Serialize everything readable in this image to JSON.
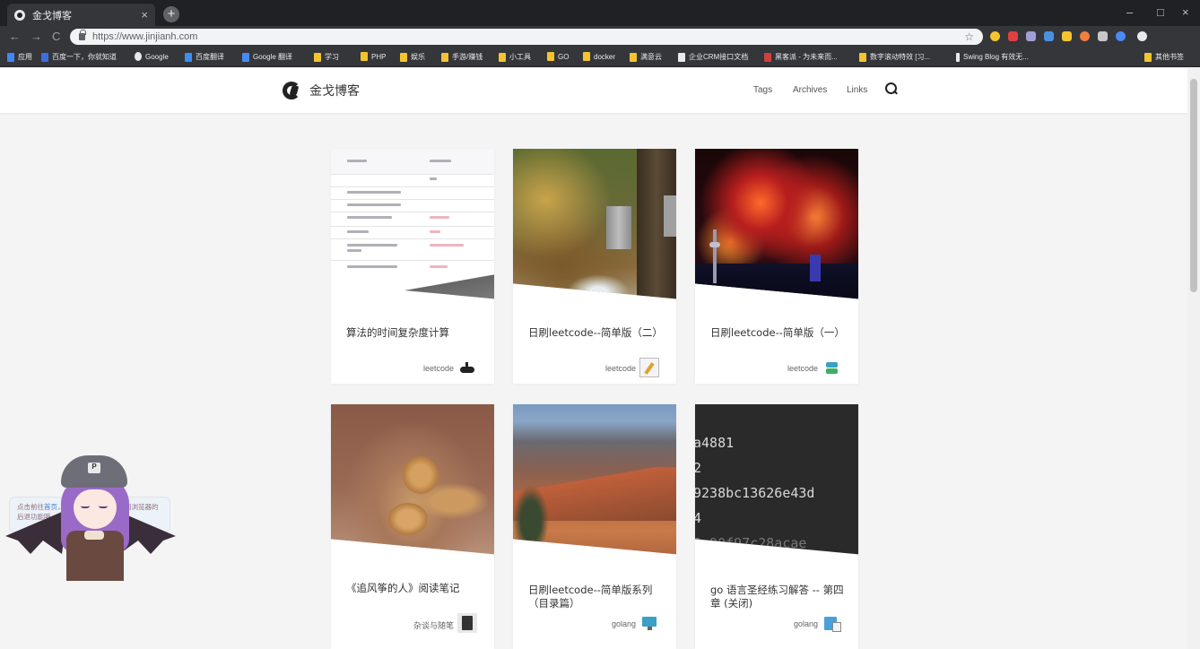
{
  "browser": {
    "tab_title": "金戈博客",
    "tab_close": "×",
    "new_tab": "+",
    "url": "https://www.jinjianh.com",
    "star": "☆",
    "window_controls": [
      "–",
      "□",
      "×"
    ],
    "nav_back": "←",
    "nav_forward": "→",
    "nav_reload": "C",
    "bookmarks": [
      {
        "label": "应用",
        "color": "#4285f4"
      },
      {
        "label": "百度一下，你就知道",
        "color": "#3b6fe0"
      },
      {
        "label": "Google",
        "color": "#e8eaed"
      },
      {
        "label": "百度翻译",
        "color": "#3b8ff0"
      },
      {
        "label": "Google 翻译",
        "color": "#4a8af4"
      },
      {
        "label": "学习",
        "color": "#f4c430"
      },
      {
        "label": "PHP",
        "color": "#f4c430"
      },
      {
        "label": "娱乐",
        "color": "#f4c430"
      },
      {
        "label": "手游/赚钱",
        "color": "#f4c430"
      },
      {
        "label": "小工具",
        "color": "#f4c430"
      },
      {
        "label": "GO",
        "color": "#f4c430"
      },
      {
        "label": "docker",
        "color": "#f4c430"
      },
      {
        "label": "满意云",
        "color": "#f4c430"
      },
      {
        "label": "企业CRM接口文档",
        "color": "#e8eaed"
      },
      {
        "label": "黑客派 - 为未来而...",
        "color": "#d04040"
      },
      {
        "label": "数字滚动特效 [习...",
        "color": "#f4c430"
      },
      {
        "label": "Swing Blog 有效无...",
        "color": "#e8eaed"
      },
      {
        "label": "其他书签",
        "color": "#f4c430"
      }
    ]
  },
  "site": {
    "name": "金戈博客",
    "nav": [
      "Tags",
      "Archives",
      "Links"
    ],
    "search_icon": "search-icon"
  },
  "posts": [
    {
      "title": "算法的时间复杂度计算",
      "category": "leetcode",
      "image": "table-screenshot",
      "emoji": "gamepad-icon"
    },
    {
      "title": "日刷leetcode--简单版（二）",
      "category": "leetcode",
      "image": "forest-photo",
      "emoji": "memo-icon"
    },
    {
      "title": "日刷leetcode--简单版（一）",
      "category": "leetcode",
      "image": "fireworks-photo",
      "emoji": "stack-icon"
    },
    {
      "title": "《追风筝的人》阅读笔记",
      "category": "杂谈与随笔",
      "image": "lion-cubs-photo",
      "emoji": "book-icon"
    },
    {
      "title": "日刷leetcode--简单版系列（目录篇）",
      "category": "golang",
      "image": "canyon-photo",
      "emoji": "monitor-icon"
    },
    {
      "title": "go 语言圣经练习解答 -- 第四章 (关闭)",
      "category": "golang",
      "image": "code-screenshot",
      "emoji": "card-icon"
    }
  ],
  "code_lines": [
    "a4881",
    "2",
    "9238bc13626e43d",
    "4",
    "8a90f97c28acae"
  ],
  "table_thumb": {
    "header_cols": [
      "数据结构",
      "时间复杂度"
    ],
    "rows": [
      "Graph of |V| vertices and |E| edges",
      "Graph of |V| vertices and |E| edges",
      "Sorted array of n elements",
      "Array",
      "Graph with |V| vertices and |E| edges",
      "Graph with |V| vertices and |E| edges"
    ]
  },
  "widget": {
    "tip_prefix": "点击前往",
    "tip_link": "首页",
    "tip_suffix": "，想回到上一页可以使用浏览器的后退功能哦。",
    "hat_badge": "P"
  }
}
